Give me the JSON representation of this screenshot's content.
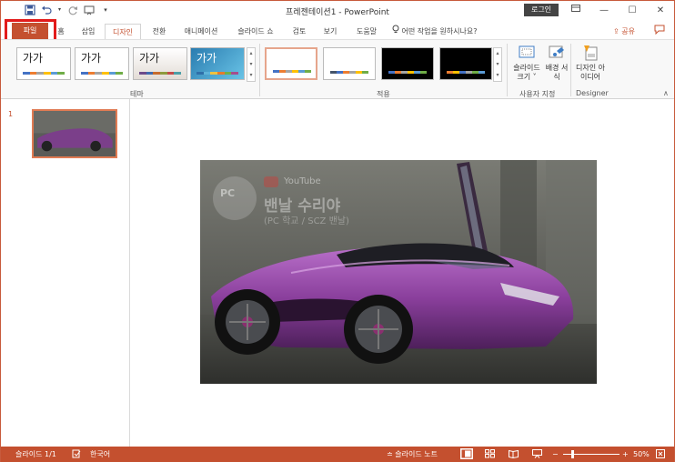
{
  "window": {
    "title": "프레젠테이션1  -  PowerPoint",
    "login_label": "로그인",
    "minimize_icon": "minimize-icon",
    "maximize_icon": "maximize-icon",
    "close_icon": "close-icon",
    "ribbon_display_icon": "ribbon-display-icon"
  },
  "qat": {
    "save_icon": "save-icon",
    "undo_icon": "undo-icon",
    "redo_icon": "redo-icon",
    "present_icon": "start-from-beginning-icon",
    "customize_icon": "customize-qat-icon"
  },
  "tabs": [
    {
      "label": "파일",
      "id": "file"
    },
    {
      "label": "홈",
      "id": "home"
    },
    {
      "label": "삽입",
      "id": "insert"
    },
    {
      "label": "디자인",
      "id": "design"
    },
    {
      "label": "전환",
      "id": "transitions"
    },
    {
      "label": "애니메이션",
      "id": "animations"
    },
    {
      "label": "슬라이드 쇼",
      "id": "slideshow"
    },
    {
      "label": "검토",
      "id": "review"
    },
    {
      "label": "보기",
      "id": "view"
    },
    {
      "label": "도움말",
      "id": "help"
    }
  ],
  "active_tab": "디자인",
  "tell_me": "어떤 작업을 원하시나요?",
  "share_label": "공유",
  "ribbon": {
    "themes": [
      {
        "label": "가가",
        "colors": [
          "#4472c4",
          "#ed7d31",
          "#a5a5a5",
          "#ffc000",
          "#5b9bd5",
          "#70ad47"
        ]
      },
      {
        "label": "가가",
        "colors": [
          "#4472c4",
          "#ed7d31",
          "#a5a5a5",
          "#ffc000",
          "#5b9bd5",
          "#70ad47"
        ]
      },
      {
        "label": "가가",
        "colors": [
          "#6d4a8a",
          "#3f6bb0",
          "#c66b2c",
          "#8e9a3d",
          "#c44b4b",
          "#4c9fa8"
        ]
      },
      {
        "label": "가가",
        "colors": [
          "#2f6fa8",
          "#5fb3d8",
          "#f0c23e",
          "#e57a2e",
          "#6fb04a",
          "#a64d8c"
        ]
      }
    ],
    "theme_group_label": "테마",
    "variants": [
      {
        "bg": "#ffffff",
        "colors": [
          "#4472c4",
          "#ed7d31",
          "#a5a5a5",
          "#ffc000",
          "#5b9bd5",
          "#70ad47"
        ]
      },
      {
        "bg": "#ffffff",
        "colors": [
          "#44546a",
          "#4472c4",
          "#ed7d31",
          "#a5a5a5",
          "#ffc000",
          "#70ad47"
        ]
      },
      {
        "bg": "#000000",
        "colors": [
          "#4472c4",
          "#ed7d31",
          "#a5a5a5",
          "#ffc000",
          "#5b9bd5",
          "#70ad47"
        ]
      },
      {
        "bg": "#000000",
        "colors": [
          "#ed7d31",
          "#ffc000",
          "#4472c4",
          "#a5a5a5",
          "#70ad47",
          "#5b9bd5"
        ]
      }
    ],
    "variant_group_label": "적용",
    "slide_size_label": "슬라이드 크기 ˅",
    "format_bg_label": "배경 서식",
    "customize_group_label": "사용자 지정",
    "design_ideas_label": "디자인 아이디어",
    "designer_group_label": "Designer"
  },
  "thumbnail": {
    "number": "1"
  },
  "slide": {
    "watermark_top": "YouTube",
    "watermark_main": "밴날 수리야",
    "watermark_sub": "(PC 학교 / SCZ 밴날)"
  },
  "status": {
    "slide_count": "슬라이드 1/1",
    "language": "한국어",
    "notes_label": "슬라이드 노트",
    "zoom": "50%"
  },
  "colors": {
    "accent": "#c4502f",
    "highlight_box": "#e21b1b"
  }
}
